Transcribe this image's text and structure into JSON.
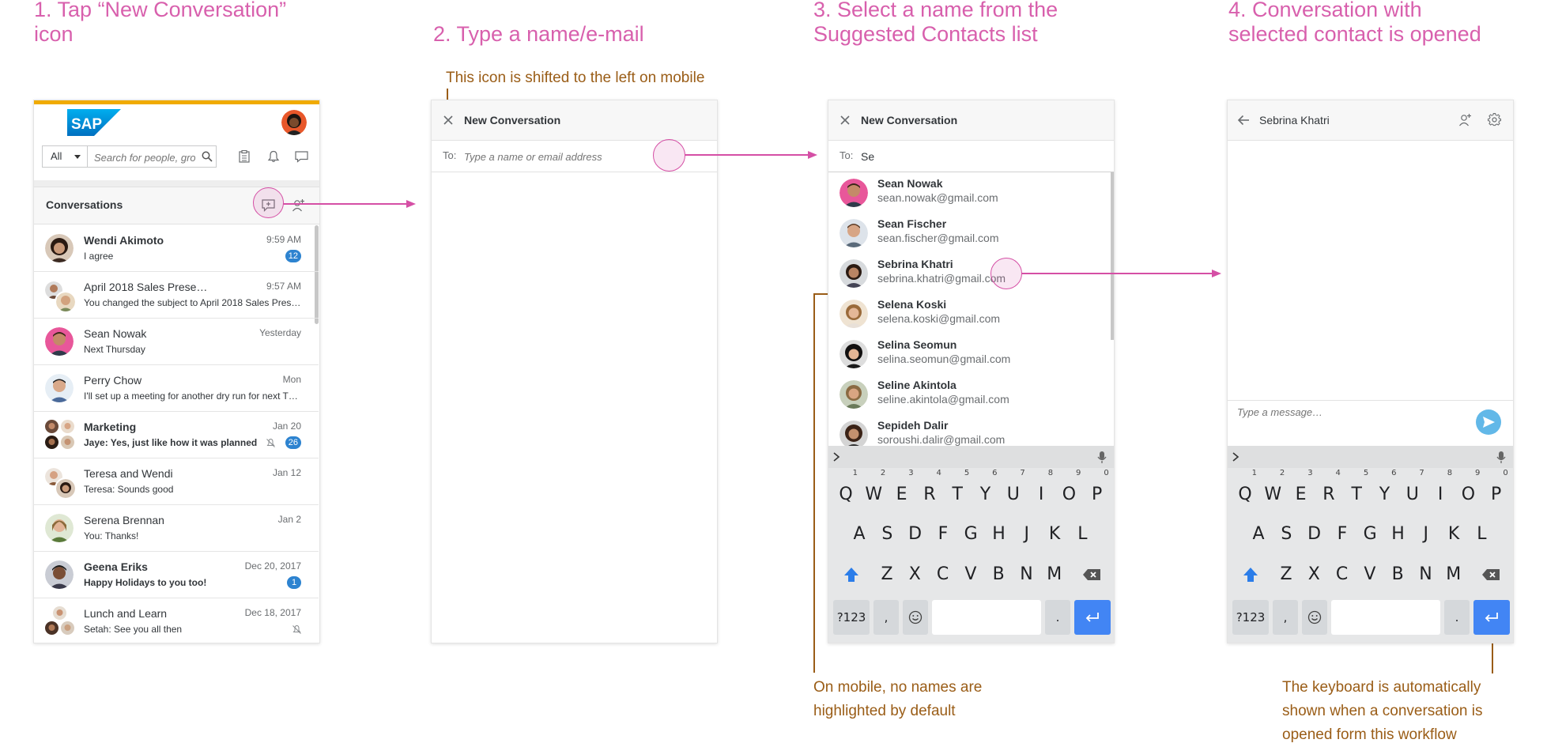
{
  "steps": [
    {
      "title": "1. Tap “New Conversation”\nicon"
    },
    {
      "title": "2. Type a name/e-mail"
    },
    {
      "title": "3. Select a name from the\nSuggested Contacts list"
    },
    {
      "title": "4. Conversation with\nselected contact is opened"
    }
  ],
  "notes": {
    "icon_shift": "This icon is shifted to the left on mobile",
    "no_highlight": "On mobile, no names are\nhighlighted by default",
    "keyboard_shown": "The keyboard is automatically\nshown when a conversation is\nopened form this workflow"
  },
  "panel1": {
    "logo": "SAP",
    "search_scope": "All",
    "search_placeholder": "Search for people, groups",
    "section_title": "Conversations",
    "conversations": [
      {
        "name": "Wendi Akimoto",
        "time": "9:59 AM",
        "message": "I agree",
        "badge": "12"
      },
      {
        "name": "April 2018 Sales Prese…",
        "time": "9:57 AM",
        "message": "You changed the subject to April 2018 Sales Pres…",
        "badge": ""
      },
      {
        "name": "Sean Nowak",
        "time": "Yesterday",
        "message": "Next Thursday",
        "badge": ""
      },
      {
        "name": "Perry Chow",
        "time": "Mon",
        "message": "I'll set up a meeting for another dry run for next T…",
        "badge": ""
      },
      {
        "name": "Marketing",
        "time": "Jan 20",
        "message": "Jaye: Yes, just like how it was planned",
        "badge": "26"
      },
      {
        "name": "Teresa and Wendi",
        "time": "Jan 12",
        "message": "Teresa: Sounds good",
        "badge": ""
      },
      {
        "name": "Serena Brennan",
        "time": "Jan 2",
        "message": "You: Thanks!",
        "badge": ""
      },
      {
        "name": "Geena Eriks",
        "time": "Dec 20, 2017",
        "message": "Happy Holidays to you too!",
        "badge": "1"
      },
      {
        "name": "Lunch and Learn",
        "time": "Dec 18, 2017",
        "message": "Setah: See you all then",
        "badge": ""
      }
    ]
  },
  "panel2": {
    "title": "New Conversation",
    "to_label": "To:",
    "to_placeholder": "Type a name or email address"
  },
  "panel3": {
    "title": "New Conversation",
    "to_label": "To:",
    "to_value": "Se",
    "contacts": [
      {
        "name": "Sean Nowak",
        "email": "sean.nowak@gmail.com"
      },
      {
        "name": "Sean Fischer",
        "email": "sean.fischer@gmail.com"
      },
      {
        "name": "Sebrina Khatri",
        "email": "sebrina.khatri@gmail.com"
      },
      {
        "name": "Selena Koski",
        "email": "selena.koski@gmail.com"
      },
      {
        "name": "Selina Seomun",
        "email": "selina.seomun@gmail.com"
      },
      {
        "name": "Seline Akintola",
        "email": "seline.akintola@gmail.com"
      },
      {
        "name": "Sepideh Dalir",
        "email": "soroushi.dalir@gmail.com"
      }
    ]
  },
  "panel4": {
    "title": "Sebrina Khatri",
    "message_placeholder": "Type a message…"
  },
  "keyboard": {
    "row1": [
      "Q",
      "W",
      "E",
      "R",
      "T",
      "Y",
      "U",
      "I",
      "O",
      "P"
    ],
    "row1_digits": [
      "1",
      "2",
      "3",
      "4",
      "5",
      "6",
      "7",
      "8",
      "9",
      "0"
    ],
    "row2": [
      "A",
      "S",
      "D",
      "F",
      "G",
      "H",
      "J",
      "K",
      "L"
    ],
    "row3": [
      "Z",
      "X",
      "C",
      "V",
      "B",
      "N",
      "M"
    ],
    "symbols_key": "?123",
    "comma_key": ",",
    "period_key": "."
  },
  "colors": {
    "accent_pink": "#d54fa5",
    "note_brown": "#9a5d17",
    "badge_blue": "#2d83d0",
    "keyboard_enter_blue": "#4285f4",
    "sap_blue": "#1a75cf",
    "top_bar_gold": "#f0ab00"
  }
}
